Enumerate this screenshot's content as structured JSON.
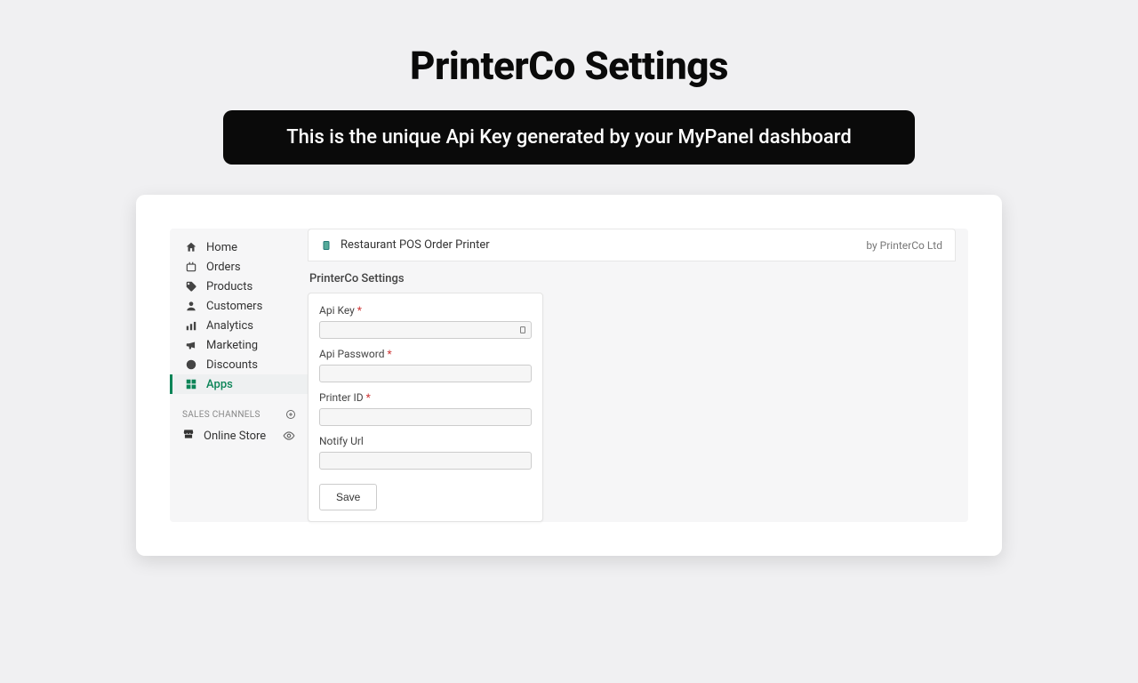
{
  "page_title": "PrinterCo Settings",
  "tooltip": "This is the unique Api Key generated by your MyPanel dashboard",
  "sidebar": {
    "items": [
      {
        "label": "Home"
      },
      {
        "label": "Orders"
      },
      {
        "label": "Products"
      },
      {
        "label": "Customers"
      },
      {
        "label": "Analytics"
      },
      {
        "label": "Marketing"
      },
      {
        "label": "Discounts"
      },
      {
        "label": "Apps"
      }
    ],
    "section_label": "SALES CHANNELS",
    "store_label": "Online Store"
  },
  "app_header": {
    "title": "Restaurant POS Order Printer",
    "byline": "by PrinterCo Ltd"
  },
  "settings": {
    "section_title": "PrinterCo Settings",
    "fields": [
      {
        "label": "Api Key",
        "required": true
      },
      {
        "label": "Api Password",
        "required": true
      },
      {
        "label": "Printer ID",
        "required": true
      },
      {
        "label": "Notify Url",
        "required": false
      }
    ],
    "required_marker": " *",
    "save_label": "Save"
  }
}
